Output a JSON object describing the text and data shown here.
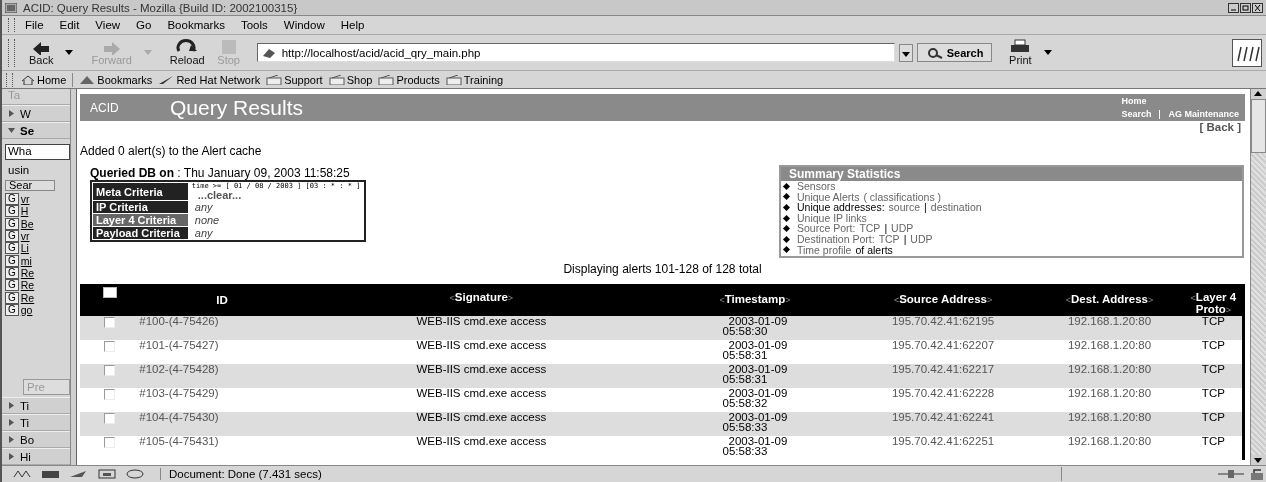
{
  "window": {
    "title": "ACID: Query Results - Mozilla {Build ID: 2002100315}"
  },
  "menu": [
    "File",
    "Edit",
    "View",
    "Go",
    "Bookmarks",
    "Tools",
    "Window",
    "Help"
  ],
  "nav": [
    {
      "label": "Back",
      "kind": "back",
      "disabled": false
    },
    {
      "label": "Forward",
      "kind": "forward",
      "disabled": true
    },
    {
      "label": "Reload",
      "kind": "reload",
      "disabled": false
    },
    {
      "label": "Stop",
      "kind": "stop",
      "disabled": true
    }
  ],
  "url": "http://localhost/acid/acid_qry_main.php",
  "search_button": "Search",
  "print_button": "Print",
  "personal_toolbar": [
    "Home",
    "Bookmarks",
    "Red Hat Network",
    "Support",
    "Shop",
    "Products",
    "Training"
  ],
  "sidebar": {
    "header": "Ta",
    "panels": [
      {
        "label": "W",
        "expanded": false
      },
      {
        "label": "Se",
        "expanded": true
      }
    ],
    "field": "Wha",
    "using": "usin",
    "search_button": "Sear",
    "results": [
      {
        "icon": "G",
        "label": "vr"
      },
      {
        "icon": "G",
        "label": "H"
      },
      {
        "icon": "G",
        "label": "Be"
      },
      {
        "icon": "G",
        "label": "vr"
      },
      {
        "icon": "G",
        "label": "Li"
      },
      {
        "icon": "G",
        "label": "mi"
      },
      {
        "icon": "G",
        "label": "Re"
      },
      {
        "icon": "G",
        "label": "Re"
      },
      {
        "icon": "G",
        "label": "Re"
      },
      {
        "icon": "G",
        "label": "go"
      }
    ],
    "prev_button": "Pre",
    "bottom_panels": [
      {
        "label": "Ti",
        "expanded": false
      },
      {
        "label": "Ti",
        "expanded": false
      },
      {
        "label": "Bo",
        "expanded": false
      },
      {
        "label": "Hi",
        "expanded": false
      }
    ]
  },
  "page": {
    "brand": "ACID",
    "title": "Query Results",
    "links": [
      "Home",
      "Search",
      "AG Maintenance"
    ],
    "back": "[ Back ]",
    "message": "Added 0 alert(s) to the Alert cache",
    "queried": "**Queried DB on** : Thu January 09, 2003 11:58:25",
    "criteria": [
      {
        "label": "Meta Criteria",
        "value": "time >= [ 01 / 08 / 2003 ] [03 : * : * ]",
        "extra": "...clear...",
        "kind": "meta",
        "highlight": false
      },
      {
        "label": "IP Criteria",
        "value": "any",
        "kind": "plain",
        "highlight": false
      },
      {
        "label": "Layer 4 Criteria",
        "value": "none",
        "kind": "plain",
        "highlight": true
      },
      {
        "label": "Payload Criteria",
        "value": "any",
        "kind": "plain",
        "highlight": false
      }
    ],
    "summary": {
      "title": "Summary Statistics",
      "items": [
        [
          {
            "text": "Sensors",
            "link": true
          }
        ],
        [
          {
            "text": "Unique Alerts",
            "link": true
          },
          {
            "text": "( classifications )",
            "link": true
          }
        ],
        [
          {
            "text": "Unique addresses:",
            "link": false
          },
          {
            "text": "source",
            "link": true
          },
          {
            "text": "|",
            "link": false
          },
          {
            "text": "destination",
            "link": true
          }
        ],
        [
          {
            "text": "Unique IP links",
            "link": true
          }
        ],
        [
          {
            "text": "Source Port:",
            "link": true
          },
          {
            "text": "TCP",
            "link": true
          },
          {
            "text": "|",
            "link": false
          },
          {
            "text": "UDP",
            "link": true
          }
        ],
        [
          {
            "text": "Destination Port:",
            "link": true
          },
          {
            "text": "TCP",
            "link": true
          },
          {
            "text": "|",
            "link": false
          },
          {
            "text": "UDP",
            "link": true
          }
        ],
        [
          {
            "text": "Time profile",
            "link": true
          },
          {
            "text": "of alerts",
            "link": false
          }
        ]
      ]
    },
    "displaying": "Displaying alerts 101-128 of 128 total",
    "table": {
      "select_all_checked": false,
      "columns": [
        {
          "label": "ID"
        },
        {
          "label": "Signature",
          "prev": "<",
          "next": ">"
        },
        {
          "label": "Timestamp",
          "prev": "<",
          "next": ">"
        },
        {
          "label": "Source Address",
          "prev": "<",
          "next": ">"
        },
        {
          "label": "Dest. Address",
          "prev": "<",
          "next": ">"
        },
        {
          "label": "Layer 4 Proto",
          "prev": "<",
          "next": ">"
        }
      ],
      "rows": [
        {
          "checked": false,
          "id": "#100-(4-75426)",
          "signature": "WEB-IIS cmd.exe access",
          "date": "2003-01-09",
          "time": "05:58:30",
          "source": "195.70.42.41:62195",
          "dest": "192.168.1.20:80",
          "proto": "TCP"
        },
        {
          "checked": false,
          "id": "#101-(4-75427)",
          "signature": "WEB-IIS cmd.exe access",
          "date": "2003-01-09",
          "time": "05:58:31",
          "source": "195.70.42.41:62207",
          "dest": "192.168.1.20:80",
          "proto": "TCP"
        },
        {
          "checked": false,
          "id": "#102-(4-75428)",
          "signature": "WEB-IIS cmd.exe access",
          "date": "2003-01-09",
          "time": "05:58:31",
          "source": "195.70.42.41:62217",
          "dest": "192.168.1.20:80",
          "proto": "TCP"
        },
        {
          "checked": false,
          "id": "#103-(4-75429)",
          "signature": "WEB-IIS cmd.exe access",
          "date": "2003-01-09",
          "time": "05:58:32",
          "source": "195.70.42.41:62228",
          "dest": "192.168.1.20:80",
          "proto": "TCP"
        },
        {
          "checked": false,
          "id": "#104-(4-75430)",
          "signature": "WEB-IIS cmd.exe access",
          "date": "2003-01-09",
          "time": "05:58:33",
          "source": "195.70.42.41:62241",
          "dest": "192.168.1.20:80",
          "proto": "TCP"
        },
        {
          "checked": false,
          "id": "#105-(4-75431)",
          "signature": "WEB-IIS cmd.exe access",
          "date": "2003-01-09",
          "time": "05:58:33",
          "source": "195.70.42.41:62251",
          "dest": "192.168.1.20:80",
          "proto": "TCP"
        }
      ]
    }
  },
  "status_bar": {
    "text": "Document: Done (7.431 secs)"
  }
}
